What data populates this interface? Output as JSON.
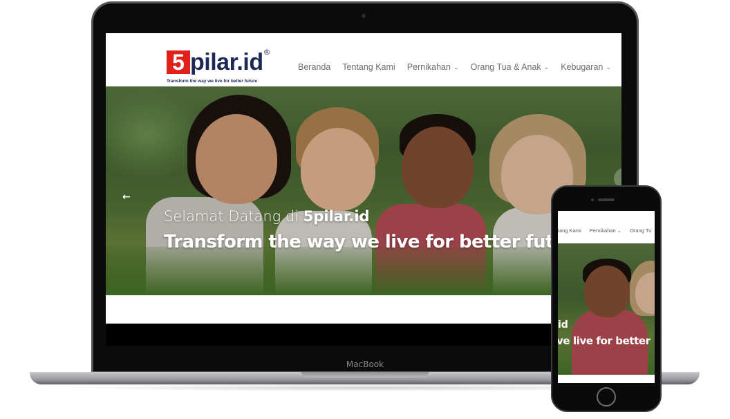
{
  "laptop": {
    "brand_label": "MacBook",
    "site": {
      "logo": {
        "number": "5",
        "word": "pilar.id",
        "registered": "®",
        "tagline": "Transform the way we live for better future"
      },
      "menu": [
        {
          "label": "Beranda",
          "has_dropdown": false
        },
        {
          "label": "Tentang Kami",
          "has_dropdown": false
        },
        {
          "label": "Pernikahan",
          "has_dropdown": true
        },
        {
          "label": "Orang Tua & Anak",
          "has_dropdown": true
        },
        {
          "label": "Kebugaran",
          "has_dropdown": true
        }
      ],
      "hero": {
        "title_prefix": "Selamat Datang di ",
        "title_brand": "5pilar.id",
        "subtitle": "Transform the way we live for better fut",
        "prev_arrow": "←"
      }
    }
  },
  "phone": {
    "menu": [
      "tang Kami",
      "Pernikahan ⌄",
      "Orang Tu"
    ],
    "hero": {
      "title": "id",
      "subtitle": "ve live for better"
    }
  },
  "colors": {
    "brand_red": "#e3211b",
    "brand_navy": "#1d2a57",
    "menu_text": "#6b6b73"
  },
  "icons": {
    "dropdown": "chevron-down-icon",
    "prev": "arrow-left-icon"
  }
}
